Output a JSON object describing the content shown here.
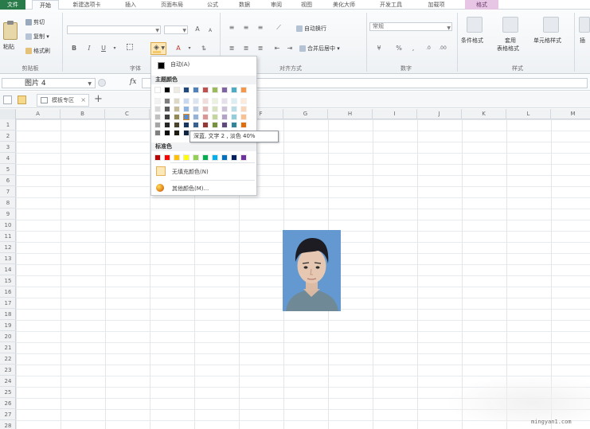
{
  "tabs": [
    {
      "label": "文件",
      "kind": "file"
    },
    {
      "label": "开始",
      "kind": "active"
    },
    {
      "label": "新建选项卡",
      "kind": "normal"
    },
    {
      "label": "插入",
      "kind": "normal"
    },
    {
      "label": "页面布局",
      "kind": "normal"
    },
    {
      "label": "公式",
      "kind": "normal"
    },
    {
      "label": "数据",
      "kind": "normal"
    },
    {
      "label": "审阅",
      "kind": "normal"
    },
    {
      "label": "视图",
      "kind": "normal"
    },
    {
      "label": "美化大师",
      "kind": "normal"
    },
    {
      "label": "开发工具",
      "kind": "normal"
    },
    {
      "label": "加载项",
      "kind": "normal"
    },
    {
      "label": "格式",
      "kind": "ctx"
    }
  ],
  "ribbon": {
    "clipboard": {
      "paste": "粘贴",
      "cut": "剪切",
      "copy": "复制",
      "format_painter": "格式刷",
      "group_label": "剪贴板"
    },
    "font": {
      "group_label": "字体",
      "bold": "B",
      "italic": "I",
      "underline": "U",
      "grow": "A",
      "shrink": "A",
      "font_color": "A"
    },
    "alignment": {
      "group_label": "对齐方式",
      "wrap_text": "自动换行",
      "merge_center": "合并后居中"
    },
    "number": {
      "group_label": "数字",
      "format_value": "常规",
      "percent": "%",
      "comma": ","
    },
    "styles": {
      "group_label": "样式",
      "conditional": "条件格式",
      "table_format_1": "套用",
      "table_format_2": "表格格式",
      "cell_styles": "单元格样式"
    },
    "insert_partial": "插"
  },
  "formula_bar": {
    "name_box": "图片 4",
    "fx": "fx",
    "formula_value": ""
  },
  "template_bar": {
    "tab_label": "模板专区",
    "close": "×",
    "add": "+"
  },
  "columns": [
    "A",
    "B",
    "C",
    "D",
    "E",
    "F",
    "G",
    "H",
    "I",
    "J",
    "K",
    "L",
    "M"
  ],
  "rows": [
    "1",
    "2",
    "3",
    "4",
    "5",
    "6",
    "7",
    "8",
    "9",
    "10",
    "11",
    "12",
    "13",
    "14",
    "15",
    "16",
    "17",
    "18",
    "19",
    "20",
    "21",
    "22",
    "23",
    "24",
    "25",
    "26",
    "27",
    "28"
  ],
  "color_menu": {
    "auto_label": "自动(A)",
    "theme_header": "主题颜色",
    "standard_header": "标准色",
    "no_fill_label": "无填充颜色(N)",
    "more_colors_label": "其他颜色(M)...",
    "theme_top_row": [
      "#ffffff",
      "#000000",
      "#eeece1",
      "#1f497d",
      "#4f81bd",
      "#c0504d",
      "#9bbb59",
      "#8064a2",
      "#4bacc6",
      "#f79646"
    ],
    "theme_shades": [
      [
        "#f2f2f2",
        "#7f7f7f",
        "#ddd9c4",
        "#c6d9f0",
        "#dbe5f1",
        "#f2dcdb",
        "#ebf1dd",
        "#e5e0ec",
        "#dbeef3",
        "#fdeada"
      ],
      [
        "#d8d8d8",
        "#595959",
        "#c4bd97",
        "#8db3e2",
        "#b8cce4",
        "#e5b9b7",
        "#d7e3bc",
        "#ccc1d9",
        "#b7dde8",
        "#fbd5b5"
      ],
      [
        "#bfbfbf",
        "#3f3f3f",
        "#938953",
        "#548dd4",
        "#95b3d7",
        "#d99694",
        "#c3d69b",
        "#b2a2c7",
        "#92cddc",
        "#fac08f"
      ],
      [
        "#a5a5a5",
        "#262626",
        "#494429",
        "#17365d",
        "#366092",
        "#953734",
        "#76923c",
        "#5f497a",
        "#31859b",
        "#e36c09"
      ],
      [
        "#7f7f7f",
        "#0c0c0c",
        "#1d1b10",
        "#0f243e",
        "#244061",
        "#632423",
        "#4f6128",
        "#3f3151",
        "#205867",
        "#974806"
      ]
    ],
    "standard_colors": [
      "#c00000",
      "#ff0000",
      "#ffc000",
      "#ffff00",
      "#92d050",
      "#00b050",
      "#00b0f0",
      "#0070c0",
      "#002060",
      "#7030a0"
    ]
  },
  "tooltip": "深蓝, 文字 2 , 淡色 40%",
  "watermark": "mingyan1.com"
}
